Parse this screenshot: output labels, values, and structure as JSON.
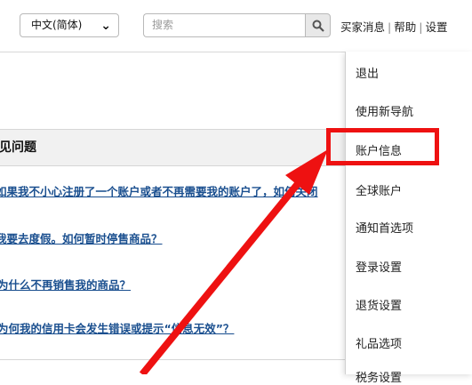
{
  "topbar": {
    "language_select": "中文(简体)",
    "search_placeholder": "搜索",
    "links": [
      "买家消息",
      "帮助",
      "设置"
    ]
  },
  "faq": {
    "header": "常见问题",
    "links": [
      "如果我不小心注册了一个账户或者不再需要我的账户了，如何关闭",
      "我要去度假。如何暂时停售商品？",
      "为什么不再销售我的商品？",
      "为何我的信用卡会发生错误或提示“信息无效”？"
    ]
  },
  "settings_menu": {
    "items": [
      "退出",
      "使用新导航",
      "账户信息",
      "全球账户",
      "通知首选项",
      "登录设置",
      "退货设置",
      "礼品选项",
      "税务设置"
    ],
    "highlighted": "账户信息"
  },
  "annotation": {
    "color": "#ee1111"
  }
}
